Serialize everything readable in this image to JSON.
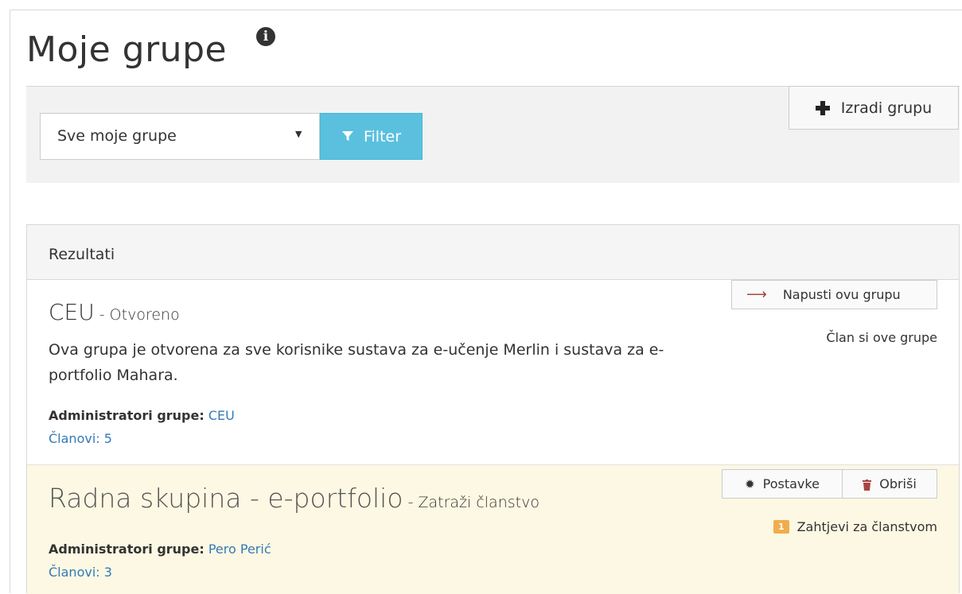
{
  "page": {
    "title": "Moje grupe",
    "info_icon": "info-icon"
  },
  "toolbar": {
    "create_group_label": "Izradi grupu",
    "create_group_icon": "plus-icon"
  },
  "filter": {
    "selected": "Sve moje grupe",
    "button_label": "Filter",
    "button_icon": "funnel-icon",
    "accent_color": "#5bc0de"
  },
  "results": {
    "title": "Rezultati",
    "groups": [
      {
        "name": "CEU",
        "type": " - Otvoreno",
        "description": "Ova grupa je otvorena za sve korisnike sustava za e-učenje Merlin i sustava za e-portfolio Mahara.",
        "admin_label": "Administratori grupe:",
        "admins": "CEU",
        "members": "Članovi: 5",
        "action_label": "Napusti ovu grupu",
        "action_icon": "arrow-right-icon",
        "status": "Član si ove grupe"
      },
      {
        "name": "Radna skupina - e-portfolio",
        "type": " - Zatraži članstvo",
        "admin_label": "Administratori grupe:",
        "admins": "Pero Perić",
        "members": "Članovi: 3",
        "settings_label": "Postavke",
        "settings_icon": "gear-icon",
        "delete_label": "Obriši",
        "delete_icon": "trash-icon",
        "requests_count": "1",
        "requests_label": "Zahtjevi za članstvom",
        "highlight_color": "#fcf8e3"
      }
    ]
  }
}
